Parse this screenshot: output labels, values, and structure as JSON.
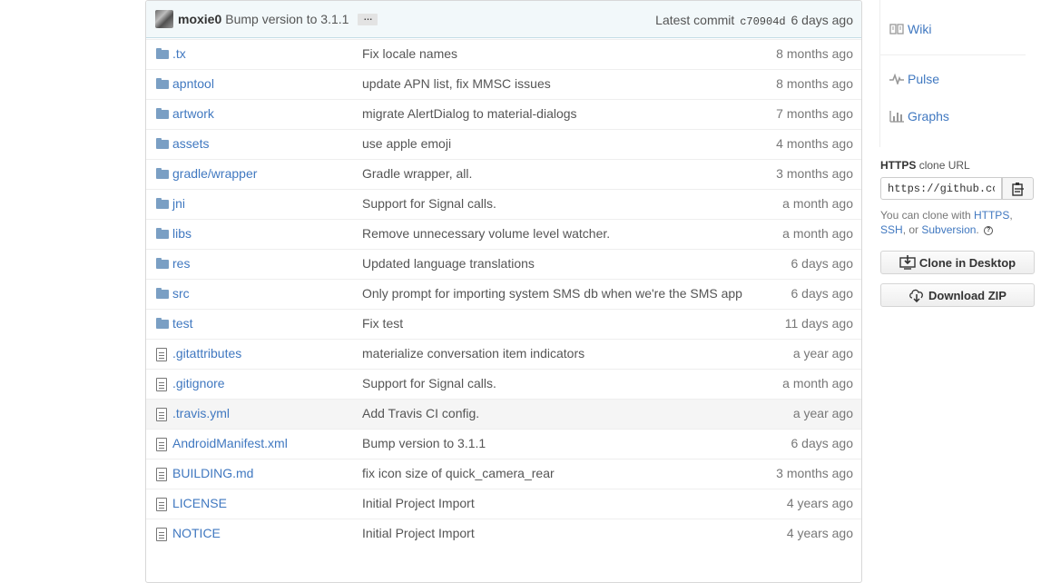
{
  "commit_bar": {
    "author": "moxie0",
    "message": "Bump version to 3.1.1",
    "ellipsis": "…",
    "latest_label": "Latest commit",
    "sha": "c70904d",
    "age": "6 days ago"
  },
  "files": [
    {
      "type": "folder",
      "name": ".tx",
      "message": "Fix locale names",
      "age": "8 months ago"
    },
    {
      "type": "folder",
      "name": "apntool",
      "message": "update APN list, fix MMSC issues",
      "age": "8 months ago"
    },
    {
      "type": "folder",
      "name": "artwork",
      "message": "migrate AlertDialog to material-dialogs",
      "age": "7 months ago"
    },
    {
      "type": "folder",
      "name": "assets",
      "message": "use apple emoji",
      "age": "4 months ago"
    },
    {
      "type": "folder",
      "name": "gradle/wrapper",
      "message": "Gradle wrapper, all.",
      "age": "3 months ago"
    },
    {
      "type": "folder",
      "name": "jni",
      "message": "Support for Signal calls.",
      "age": "a month ago"
    },
    {
      "type": "folder",
      "name": "libs",
      "message": "Remove unnecessary volume level watcher.",
      "age": "a month ago"
    },
    {
      "type": "folder",
      "name": "res",
      "message": "Updated language translations",
      "age": "6 days ago"
    },
    {
      "type": "folder",
      "name": "src",
      "message": "Only prompt for importing system SMS db when we're the SMS app",
      "age": "6 days ago"
    },
    {
      "type": "folder",
      "name": "test",
      "message": "Fix test",
      "age": "11 days ago"
    },
    {
      "type": "file",
      "name": ".gitattributes",
      "message": "materialize conversation item indicators",
      "age": "a year ago"
    },
    {
      "type": "file",
      "name": ".gitignore",
      "message": "Support for Signal calls.",
      "age": "a month ago"
    },
    {
      "type": "file",
      "name": ".travis.yml",
      "message": "Add Travis CI config.",
      "age": "a year ago"
    },
    {
      "type": "file",
      "name": "AndroidManifest.xml",
      "message": "Bump version to 3.1.1",
      "age": "6 days ago"
    },
    {
      "type": "file",
      "name": "BUILDING.md",
      "message": "fix icon size of quick_camera_rear",
      "age": "3 months ago"
    },
    {
      "type": "file",
      "name": "LICENSE",
      "message": "Initial Project Import",
      "age": "4 years ago"
    },
    {
      "type": "file",
      "name": "NOTICE",
      "message": "Initial Project Import",
      "age": "4 years ago"
    }
  ],
  "sidebar": {
    "wiki": "Wiki",
    "pulse": "Pulse",
    "graphs": "Graphs"
  },
  "clone": {
    "protocol": "HTTPS",
    "label": "clone URL",
    "url": "https://github.com/WhisperSystems/Signal-Android.git",
    "help_prefix": "You can clone with",
    "https": "HTTPS",
    "comma": ",",
    "ssh": "SSH",
    "or": ", or",
    "subversion": "Subversion",
    "period": ".",
    "help_icon": "?"
  },
  "buttons": {
    "clone_desktop": "Clone in Desktop",
    "download_zip": "Download ZIP"
  }
}
